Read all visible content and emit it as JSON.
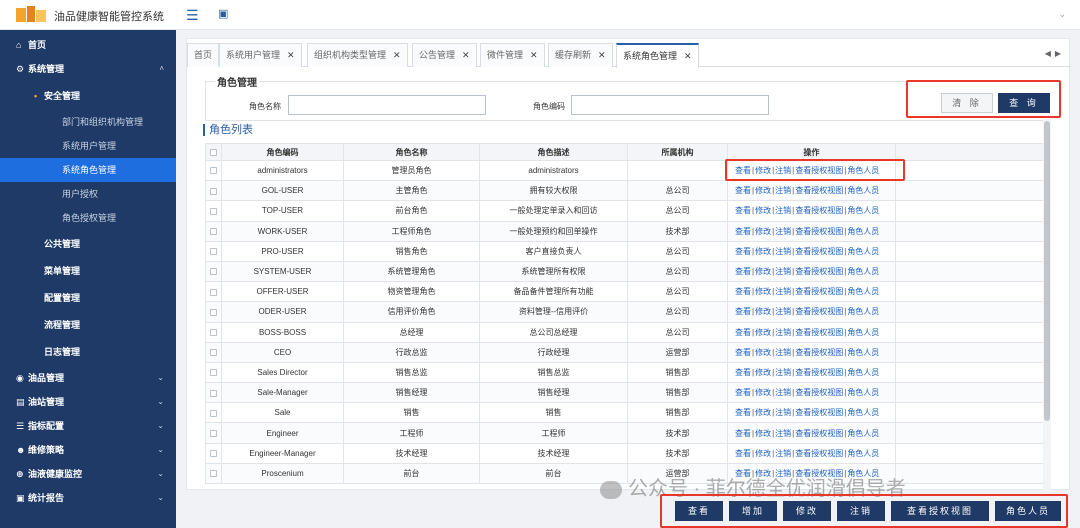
{
  "app": {
    "title": "油品健康智能管控系统"
  },
  "sidebar": {
    "home": "首页",
    "system": "系统管理",
    "security": "安全管理",
    "security_items": [
      "部门和组织机构管理",
      "系统用户管理",
      "系统角色管理",
      "用户授权",
      "角色授权管理"
    ],
    "mid_items": [
      "公共管理",
      "菜单管理",
      "配置管理",
      "流程管理",
      "日志管理"
    ],
    "groups": [
      "油品管理",
      "油站管理",
      "指标配置",
      "维修策略",
      "油液健康监控",
      "统计报告"
    ]
  },
  "tabs": [
    "首页",
    "系统用户管理",
    "组织机构类型管理",
    "公告管理",
    "微件管理",
    "缓存刷新",
    "系统角色管理"
  ],
  "search": {
    "legend": "角色管理",
    "name_label": "角色名称",
    "name_value": "",
    "code_label": "角色编码",
    "code_value": "",
    "clear_label": "清 除",
    "query_label": "查 询"
  },
  "list": {
    "title": "角色列表",
    "headers": [
      "角色编码",
      "角色名称",
      "角色描述",
      "所属机构",
      "操作"
    ],
    "op_labels": [
      "查看",
      "修改",
      "注销",
      "查看授权视图",
      "角色人员"
    ],
    "rows": [
      [
        "administrators",
        "管理员角色",
        "administrators",
        ""
      ],
      [
        "GOL-USER",
        "主管角色",
        "拥有较大权限",
        "总公司"
      ],
      [
        "TOP-USER",
        "前台角色",
        "一般处理定单录入和回访",
        "总公司"
      ],
      [
        "WORK-USER",
        "工程师角色",
        "一般处理预约和回单操作",
        "技术部"
      ],
      [
        "PRO-USER",
        "销售角色",
        "客户直接负责人",
        "总公司"
      ],
      [
        "SYSTEM-USER",
        "系统管理角色",
        "系统管理所有权限",
        "总公司"
      ],
      [
        "OFFER-USER",
        "物资管理角色",
        "备品备件管理所有功能",
        "总公司"
      ],
      [
        "ODER-USER",
        "信用评价角色",
        "资料管理--信用评价",
        "总公司"
      ],
      [
        "BOSS-BOSS",
        "总经理",
        "总公司总经理",
        "总公司"
      ],
      [
        "CEO",
        "行政总监",
        "行政经理",
        "运营部"
      ],
      [
        "Sales Director",
        "销售总监",
        "销售总监",
        "销售部"
      ],
      [
        "Sale-Manager",
        "销售经理",
        "销售经理",
        "销售部"
      ],
      [
        "Sale",
        "销售",
        "销售",
        "销售部"
      ],
      [
        "Engineer",
        "工程师",
        "工程师",
        "技术部"
      ],
      [
        "Engineer-Manager",
        "技术经理",
        "技术经理",
        "技术部"
      ],
      [
        "Proscenium",
        "前台",
        "前台",
        "运营部"
      ]
    ]
  },
  "bottom_buttons": [
    "查看",
    "增加",
    "修改",
    "注销",
    "查看授权视图",
    "角色人员"
  ],
  "watermark": "公众号 · 菲尔德全优润滑倡导者",
  "colors": {
    "sidebar": "#1f3a66",
    "active": "#1e6ee0",
    "link": "#1d5fbf",
    "highlight": "#e8362b"
  }
}
